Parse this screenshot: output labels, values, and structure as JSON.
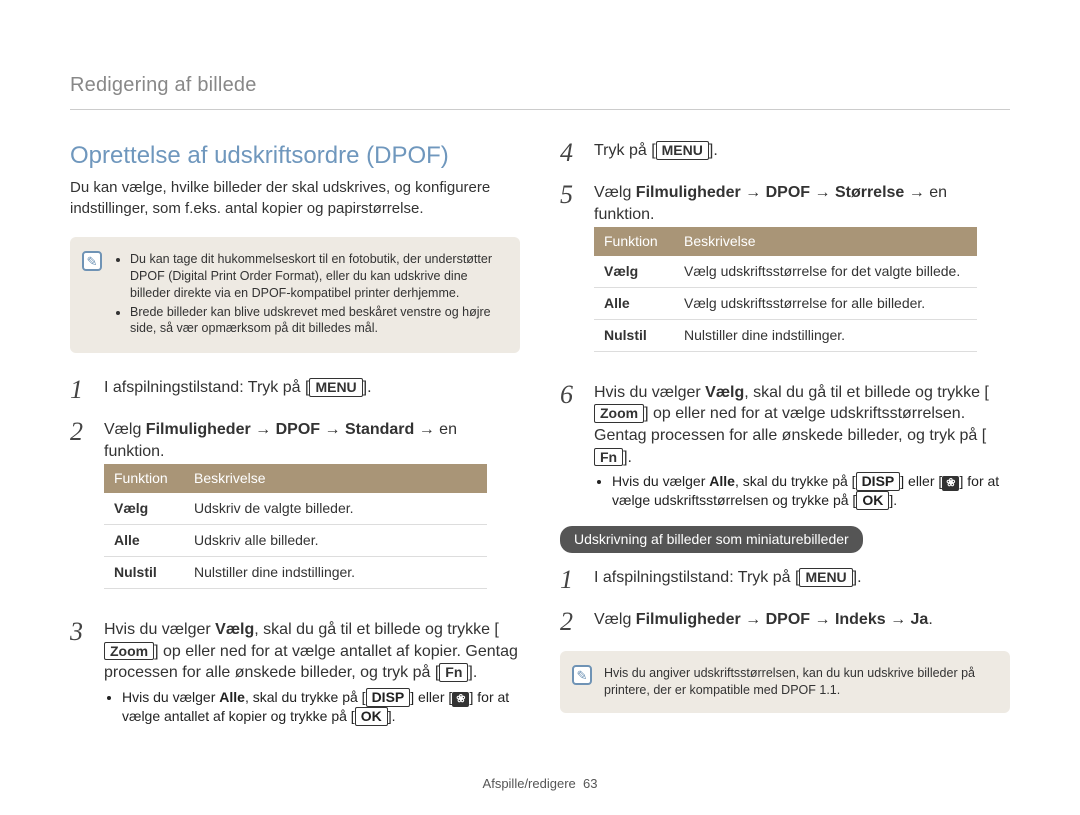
{
  "header": "Redigering af billede",
  "title": "Oprettelse af udskriftsordre (DPOF)",
  "intro": "Du kan vælge, hvilke billeder der skal udskrives, og konfigurere indstillinger, som f.eks. antal kopier og papirstørrelse.",
  "note1": {
    "items": [
      "Du kan tage dit hukommelseskort til en fotobutik, der understøtter DPOF (Digital Print Order Format), eller du kan udskrive dine billeder direkte via en DPOF-kompatibel printer derhjemme.",
      "Brede billeder kan blive udskrevet med beskåret venstre og højre side, så vær opmærksom på dit billedes mål."
    ]
  },
  "labels": {
    "menu": "MENU",
    "zoom": "Zoom",
    "fn": "Fn",
    "disp": "DISP",
    "ok": "OK",
    "macro": "❀"
  },
  "left_steps": {
    "s1_a": "I afspilningstilstand: Tryk på [",
    "s1_b": "].",
    "s2_a": "Vælg ",
    "s2_b": "Filmuligheder",
    "s2_c": " → ",
    "s2_d": "DPOF",
    "s2_e": " → ",
    "s2_f": "Standard",
    "s2_g": " → en funktion.",
    "s3_a": "Hvis du vælger ",
    "s3_b": "Vælg",
    "s3_c": ", skal du gå til et billede og trykke [",
    "s3_d": "] op eller ned for at vælge antallet af kopier. Gentag processen for alle ønskede billeder, og tryk på [",
    "s3_e": "].",
    "s3_sub_a": "Hvis du vælger ",
    "s3_sub_b": "Alle",
    "s3_sub_c": ", skal du trykke på [",
    "s3_sub_d": "] eller [",
    "s3_sub_e": "] for at vælge antallet af kopier og trykke på [",
    "s3_sub_f": "]."
  },
  "left_table": {
    "h1": "Funktion",
    "h2": "Beskrivelse",
    "rows": [
      {
        "f": "Vælg",
        "d": "Udskriv de valgte billeder."
      },
      {
        "f": "Alle",
        "d": "Udskriv alle billeder."
      },
      {
        "f": "Nulstil",
        "d": "Nulstiller dine indstillinger."
      }
    ]
  },
  "right_steps": {
    "s4_a": "Tryk på [",
    "s4_b": "].",
    "s5_a": "Vælg ",
    "s5_b": "Filmuligheder",
    "s5_c": " → ",
    "s5_d": "DPOF",
    "s5_e": " → ",
    "s5_f": "Størrelse",
    "s5_g": " → en funktion.",
    "s6_a": "Hvis du vælger ",
    "s6_b": "Vælg",
    "s6_c": ", skal du gå til et billede og trykke [",
    "s6_d": "] op eller ned for at vælge udskriftsstørrelsen. Gentag processen for alle ønskede billeder, og tryk på [",
    "s6_e": "].",
    "s6_sub_a": "Hvis du vælger ",
    "s6_sub_b": "Alle",
    "s6_sub_c": ", skal du trykke på [",
    "s6_sub_d": "] eller [",
    "s6_sub_e": "] for at vælge udskriftsstørrelsen og trykke på [",
    "s6_sub_f": "]."
  },
  "right_table": {
    "h1": "Funktion",
    "h2": "Beskrivelse",
    "rows": [
      {
        "f": "Vælg",
        "d": "Vælg udskriftsstørrelse for det valgte billede."
      },
      {
        "f": "Alle",
        "d": "Vælg udskriftsstørrelse for alle billeder."
      },
      {
        "f": "Nulstil",
        "d": "Nulstiller dine indstillinger."
      }
    ]
  },
  "pill": "Udskrivning af billeder som miniaturebilleder",
  "mini_steps": {
    "s1_a": "I afspilningstilstand: Tryk på [",
    "s1_b": "].",
    "s2_a": "Vælg ",
    "s2_b": "Filmuligheder",
    "s2_c": " → ",
    "s2_d": "DPOF",
    "s2_e": " → ",
    "s2_f": "Indeks",
    "s2_g": " → ",
    "s2_h": "Ja",
    "s2_i": "."
  },
  "note2": "Hvis du angiver udskriftsstørrelsen, kan du kun udskrive billeder på printere, der er kompatible med DPOF 1.1.",
  "footer_a": "Afspille/redigere",
  "footer_b": "63"
}
